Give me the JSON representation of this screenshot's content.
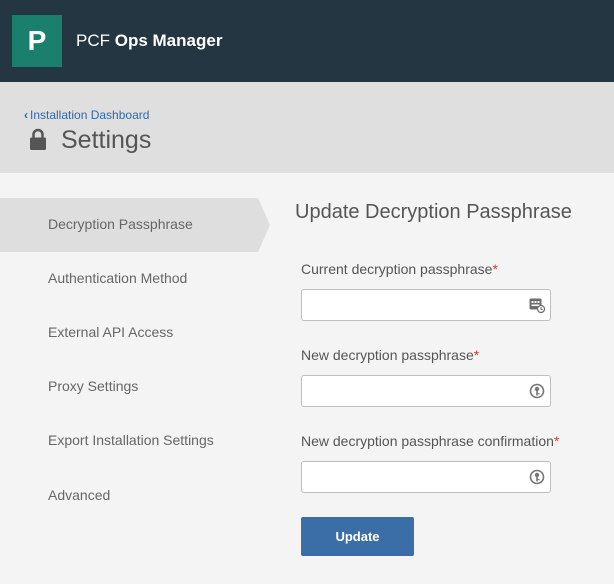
{
  "app": {
    "logo_letter": "P",
    "title_prefix": "PCF",
    "title_name": "Ops Manager"
  },
  "header": {
    "back_link": "Installation Dashboard",
    "page_title": "Settings"
  },
  "sidebar": {
    "items": [
      {
        "label": "Decryption Passphrase",
        "active": true
      },
      {
        "label": "Authentication Method"
      },
      {
        "label": "External API Access"
      },
      {
        "label": "Proxy Settings"
      },
      {
        "label": "Export Installation Settings"
      },
      {
        "label": "Advanced"
      }
    ]
  },
  "form": {
    "title": "Update Decryption Passphrase",
    "required_marker": "*",
    "fields": [
      {
        "label": "Current decryption passphrase",
        "value": "",
        "icon": "password-manager-icon"
      },
      {
        "label": "New decryption passphrase",
        "value": "",
        "icon": "key-icon"
      },
      {
        "label": "New decryption passphrase confirmation",
        "value": "",
        "icon": "key-icon"
      }
    ],
    "submit_label": "Update"
  }
}
